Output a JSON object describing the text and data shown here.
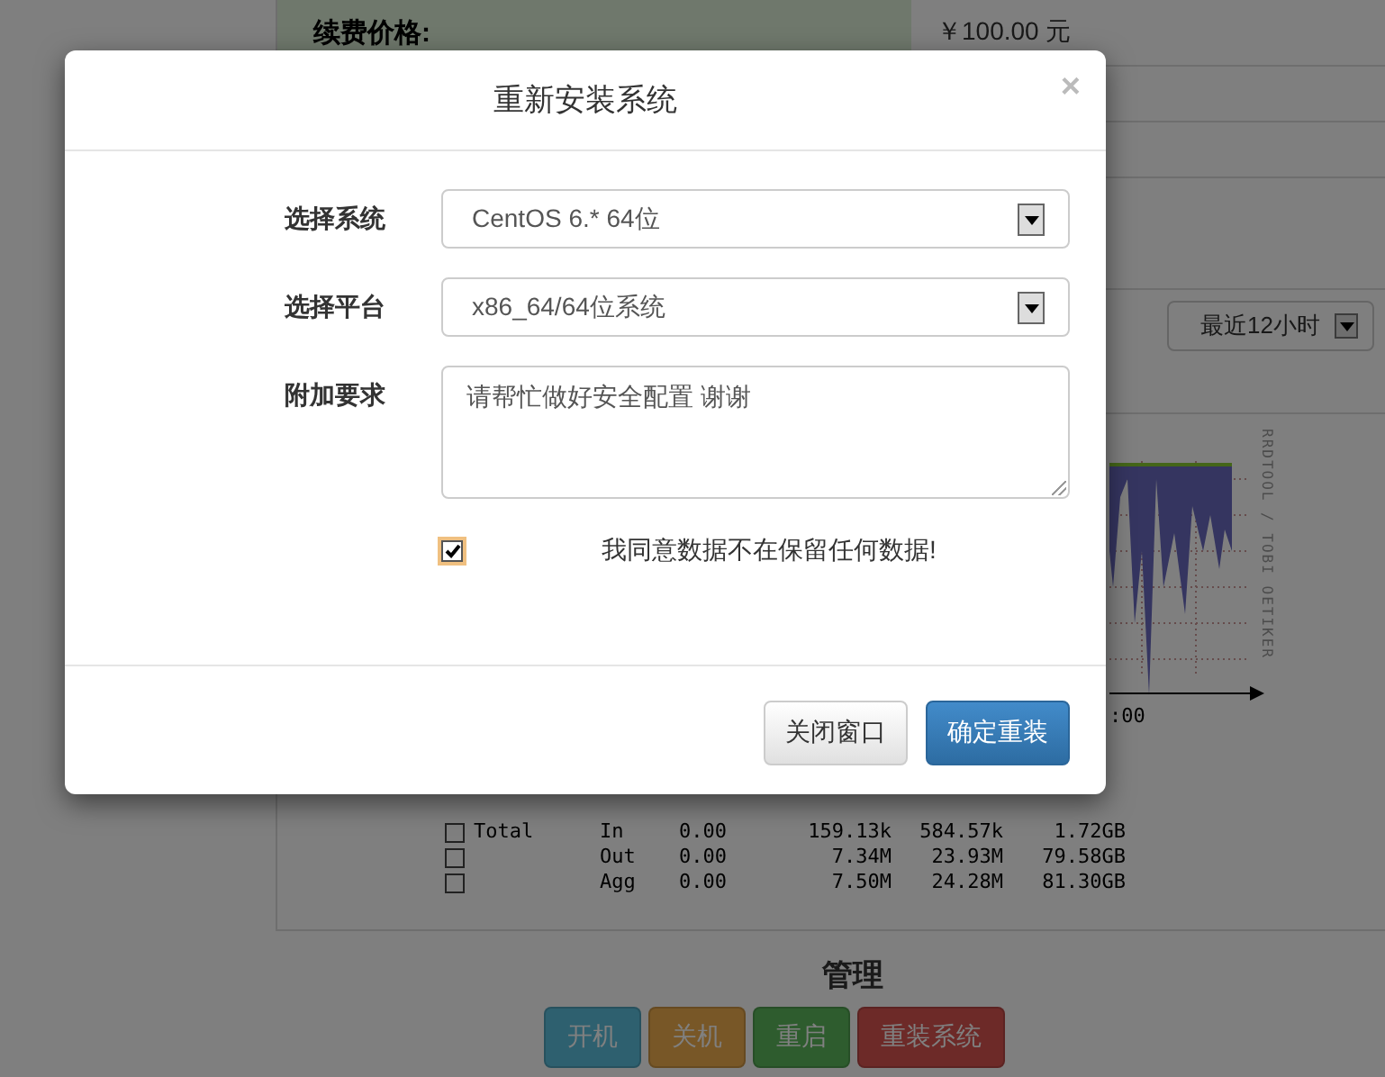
{
  "background": {
    "renewal_label": "续费价格:",
    "renewal_value": "￥100.00 元",
    "range_select": {
      "value": "最近12小时"
    },
    "graph": {
      "axis_label": ":00",
      "caption": "RRDTOOL / TOBI OETIKER"
    },
    "traffic_rows": [
      {
        "checked": false,
        "name": "Total",
        "cells": [
          "In",
          "0.00",
          "159.13k",
          "584.57k",
          "1.72GB"
        ]
      },
      {
        "checked": false,
        "name": "",
        "cells": [
          "Out",
          "0.00",
          "7.34M",
          "23.93M",
          "79.58GB"
        ]
      },
      {
        "checked": false,
        "name": "",
        "cells": [
          "Agg",
          "0.00",
          "7.50M",
          "24.28M",
          "81.30GB"
        ]
      }
    ],
    "manage": {
      "title": "管理",
      "buttons": [
        {
          "label": "开机",
          "color": "#2e606f"
        },
        {
          "label": "关机",
          "color": "#785727"
        },
        {
          "label": "重启",
          "color": "#2e5c2e"
        },
        {
          "label": "重装系统",
          "color": "#6d2a28"
        }
      ]
    }
  },
  "modal": {
    "title": "重新安装系统",
    "close": "×",
    "fields": [
      {
        "kind": "select",
        "label": "选择系统",
        "value": "CentOS 6.* 64位"
      },
      {
        "kind": "select",
        "label": "选择平台",
        "value": "x86_64/64位系统"
      },
      {
        "kind": "textarea",
        "label": "附加要求",
        "value": "请帮忙做好安全配置 谢谢"
      }
    ],
    "agree": {
      "checked": true,
      "label": "我同意数据不在保留任何数据!"
    },
    "buttons": [
      {
        "label": "关闭窗口",
        "kind": "default"
      },
      {
        "label": "确定重装",
        "kind": "primary"
      }
    ]
  }
}
